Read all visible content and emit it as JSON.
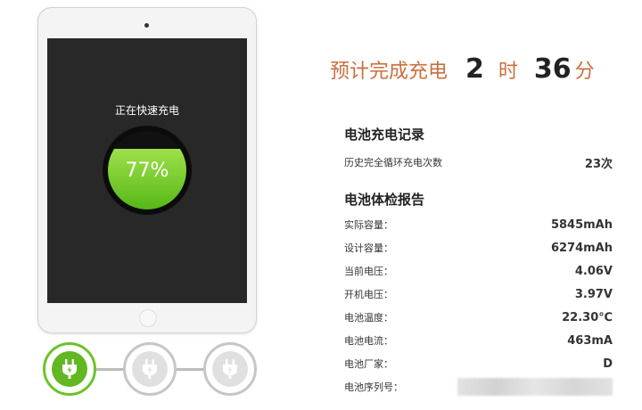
{
  "device": {
    "status_text": "正在快速充电",
    "battery_percent_text": "77%",
    "battery_level": 0.77
  },
  "estimate": {
    "label": "预计完成充电",
    "hours": "2",
    "hours_unit": "时",
    "minutes": "36",
    "minutes_unit": "分"
  },
  "charge_record": {
    "title": "电池充电记录",
    "rows": [
      {
        "label": "历史完全循环充电次数",
        "value": "23次"
      }
    ]
  },
  "health_report": {
    "title": "电池体检报告",
    "rows": [
      {
        "label": "实际容量：",
        "value": "5845mAh"
      },
      {
        "label": "设计容量：",
        "value": "6274mAh"
      },
      {
        "label": "当前电压：",
        "value": "4.06V"
      },
      {
        "label": "开机电压：",
        "value": "3.97V"
      },
      {
        "label": "电池温度：",
        "value": "22.30℃"
      },
      {
        "label": "电池电流：",
        "value": "463mA"
      },
      {
        "label": "电池厂家：",
        "value": "D"
      },
      {
        "label": "电池序列号：",
        "value": ""
      }
    ]
  },
  "stages": [
    {
      "name": "fast-charge",
      "icon": "plug-icon",
      "active": true
    },
    {
      "name": "continuous-charge",
      "icon": "plug-icon",
      "active": false
    },
    {
      "name": "trickle-charge",
      "icon": "plug-icon",
      "active": false
    }
  ],
  "colors": {
    "accent_orange": "#c96f3e",
    "charge_green": "#62b723",
    "screen_bg": "#282828"
  }
}
